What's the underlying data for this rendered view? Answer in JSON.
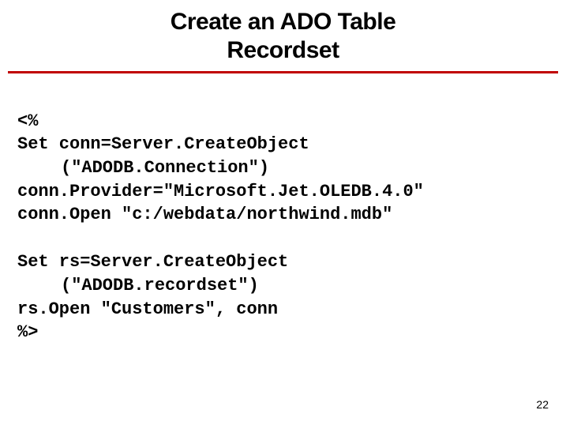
{
  "title_line1": "Create an ADO Table",
  "title_line2": "Recordset",
  "code": {
    "l1": "<%",
    "l2": "Set conn=Server.CreateObject",
    "l3": "(\"ADODB.Connection\")",
    "l4": "conn.Provider=\"Microsoft.Jet.OLEDB.4.0\"",
    "l5": "conn.Open \"c:/webdata/northwind.mdb\"",
    "l6": "Set rs=Server.CreateObject",
    "l7": "(\"ADODB.recordset\")",
    "l8": "rs.Open \"Customers\", conn",
    "l9": "%>"
  },
  "page_number": "22"
}
